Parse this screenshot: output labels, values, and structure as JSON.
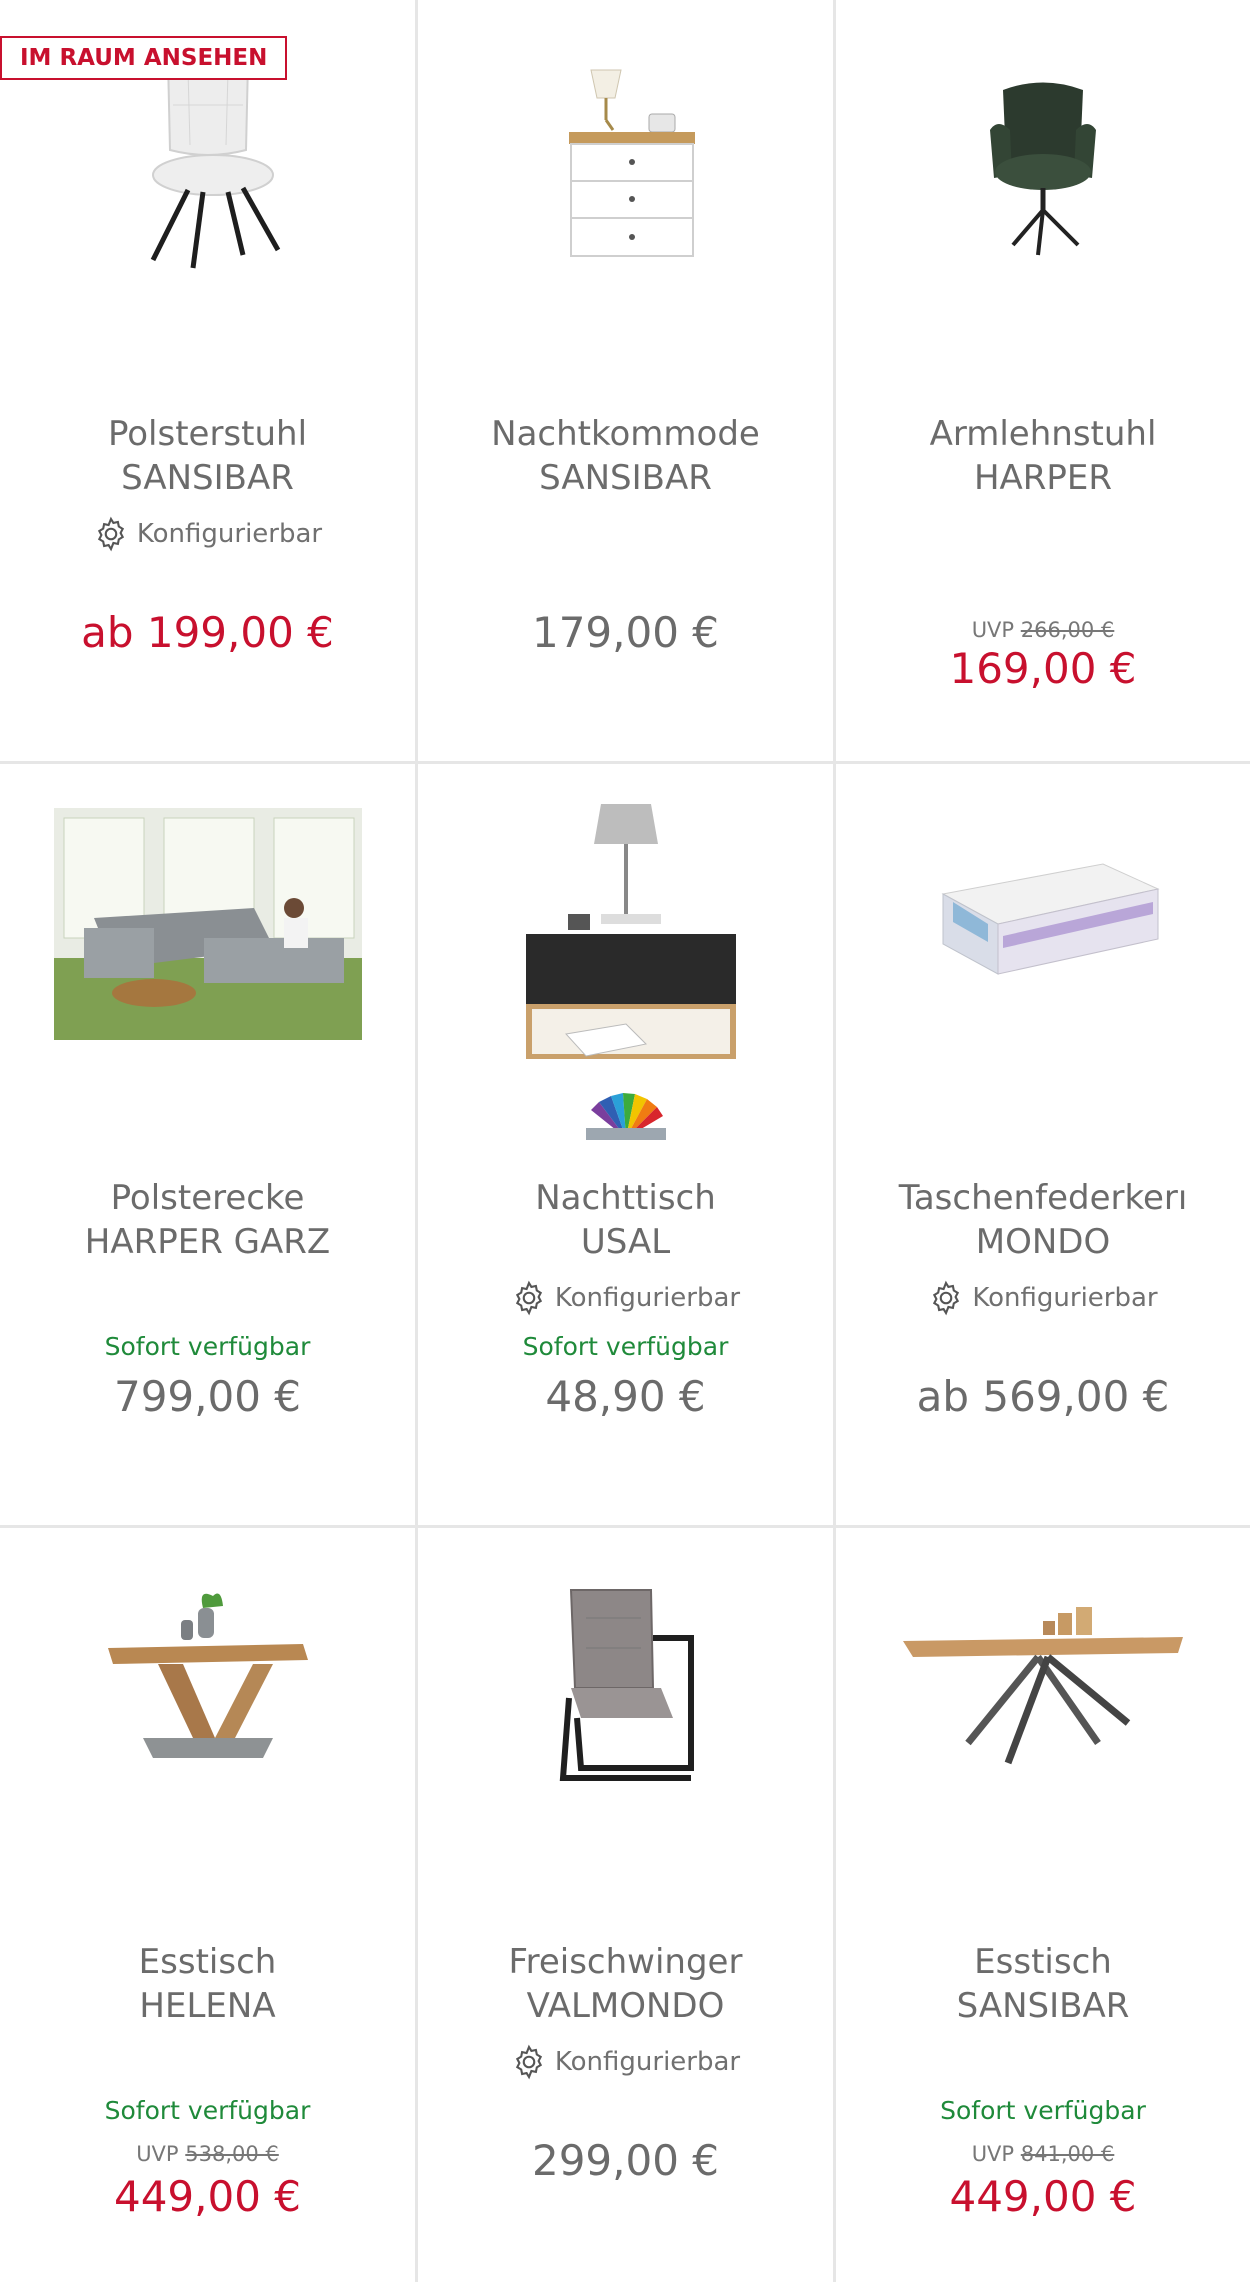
{
  "colors": {
    "accent_red": "#c8102e",
    "available_green": "#1f8a3a",
    "text_gray": "#6b6b6b",
    "divider": "#e6e6e6"
  },
  "products": [
    {
      "badge": "IM RAUM ANSEHEN",
      "title_line1": "Polsterstuhl",
      "title_line2": "SANSIBAR",
      "configurable": "Konfigurierbar",
      "price": "ab 199,00 €",
      "image_icon": "chair-icon"
    },
    {
      "title_line1": "Nachtkommode",
      "title_line2": "SANSIBAR",
      "price": "179,00 €",
      "image_icon": "dresser-icon"
    },
    {
      "title_line1": "Armlehnstuhl",
      "title_line2": "HARPER",
      "uvp_label": "UVP",
      "uvp_value": "266,00 €",
      "price": "169,00 €",
      "image_icon": "armchair-icon"
    },
    {
      "title_line1": "Polsterecke",
      "title_line2": "HARPER GARZ",
      "availability": "Sofort verfügbar",
      "price": "799,00 €",
      "image_icon": "sofa-photo-icon"
    },
    {
      "title_line1": "Nachttisch",
      "title_line2": "USAL",
      "configurable": "Konfigurierbar",
      "availability": "Sofort verfügbar",
      "price": "48,90 €",
      "image_icon": "nightstand-icon",
      "swatch_icon": "color-fan-icon"
    },
    {
      "title_line1": "Taschenfederkerı",
      "title_line2": "MONDO",
      "configurable": "Konfigurierbar",
      "price": "ab 569,00 €",
      "image_icon": "mattress-icon"
    },
    {
      "title_line1": "Esstisch",
      "title_line2": "HELENA",
      "availability": "Sofort verfügbar",
      "uvp_label": "UVP",
      "uvp_value": "538,00 €",
      "price": "449,00 €",
      "image_icon": "table-icon"
    },
    {
      "title_line1": "Freischwinger",
      "title_line2": "VALMONDO",
      "configurable": "Konfigurierbar",
      "price": "299,00 €",
      "image_icon": "cantilever-chair-icon"
    },
    {
      "title_line1": "Esstisch",
      "title_line2": "SANSIBAR",
      "availability": "Sofort verfügbar",
      "uvp_label": "UVP",
      "uvp_value": "841,00 €",
      "price": "449,00 €",
      "image_icon": "table-icon"
    }
  ]
}
